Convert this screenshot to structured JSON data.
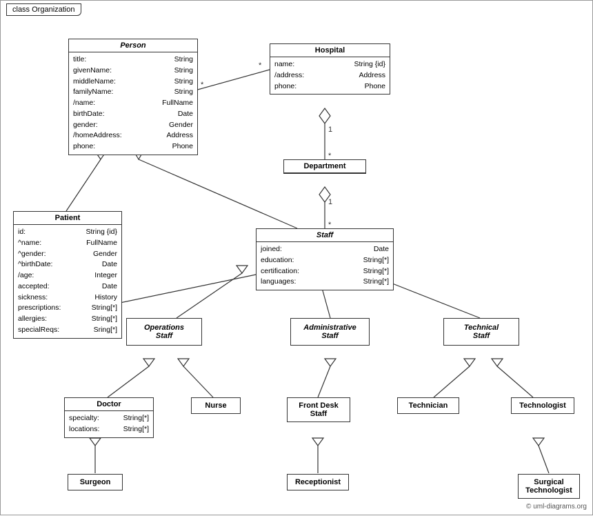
{
  "title": "class Organization",
  "classes": {
    "person": {
      "name": "Person",
      "italic": true,
      "attrs": [
        {
          "name": "title:",
          "type": "String"
        },
        {
          "name": "givenName:",
          "type": "String"
        },
        {
          "name": "middleName:",
          "type": "String"
        },
        {
          "name": "familyName:",
          "type": "String"
        },
        {
          "name": "/name:",
          "type": "FullName"
        },
        {
          "name": "birthDate:",
          "type": "Date"
        },
        {
          "name": "gender:",
          "type": "Gender"
        },
        {
          "name": "/homeAddress:",
          "type": "Address"
        },
        {
          "name": "phone:",
          "type": "Phone"
        }
      ]
    },
    "hospital": {
      "name": "Hospital",
      "italic": false,
      "attrs": [
        {
          "name": "name:",
          "type": "String {id}"
        },
        {
          "name": "/address:",
          "type": "Address"
        },
        {
          "name": "phone:",
          "type": "Phone"
        }
      ]
    },
    "patient": {
      "name": "Patient",
      "italic": false,
      "attrs": [
        {
          "name": "id:",
          "type": "String {id}"
        },
        {
          "name": "^name:",
          "type": "FullName"
        },
        {
          "name": "^gender:",
          "type": "Gender"
        },
        {
          "name": "^birthDate:",
          "type": "Date"
        },
        {
          "name": "/age:",
          "type": "Integer"
        },
        {
          "name": "accepted:",
          "type": "Date"
        },
        {
          "name": "sickness:",
          "type": "History"
        },
        {
          "name": "prescriptions:",
          "type": "String[*]"
        },
        {
          "name": "allergies:",
          "type": "String[*]"
        },
        {
          "name": "specialReqs:",
          "type": "Sring[*]"
        }
      ]
    },
    "department": {
      "name": "Department",
      "italic": false,
      "attrs": []
    },
    "staff": {
      "name": "Staff",
      "italic": true,
      "attrs": [
        {
          "name": "joined:",
          "type": "Date"
        },
        {
          "name": "education:",
          "type": "String[*]"
        },
        {
          "name": "certification:",
          "type": "String[*]"
        },
        {
          "name": "languages:",
          "type": "String[*]"
        }
      ]
    },
    "operationsStaff": {
      "name": "Operations\nStaff",
      "italic": true
    },
    "administrativeStaff": {
      "name": "Administrative\nStaff",
      "italic": true
    },
    "technicalStaff": {
      "name": "Technical\nStaff",
      "italic": true
    },
    "doctor": {
      "name": "Doctor",
      "italic": false,
      "attrs": [
        {
          "name": "specialty:",
          "type": "String[*]"
        },
        {
          "name": "locations:",
          "type": "String[*]"
        }
      ]
    },
    "nurse": {
      "name": "Nurse"
    },
    "frontDeskStaff": {
      "name": "Front Desk\nStaff"
    },
    "technician": {
      "name": "Technician"
    },
    "technologist": {
      "name": "Technologist"
    },
    "surgeon": {
      "name": "Surgeon"
    },
    "receptionist": {
      "name": "Receptionist"
    },
    "surgicalTechnologist": {
      "name": "Surgical\nTechnologist"
    }
  },
  "multiplicity": {
    "star": "*",
    "one": "1"
  },
  "copyright": "© uml-diagrams.org"
}
